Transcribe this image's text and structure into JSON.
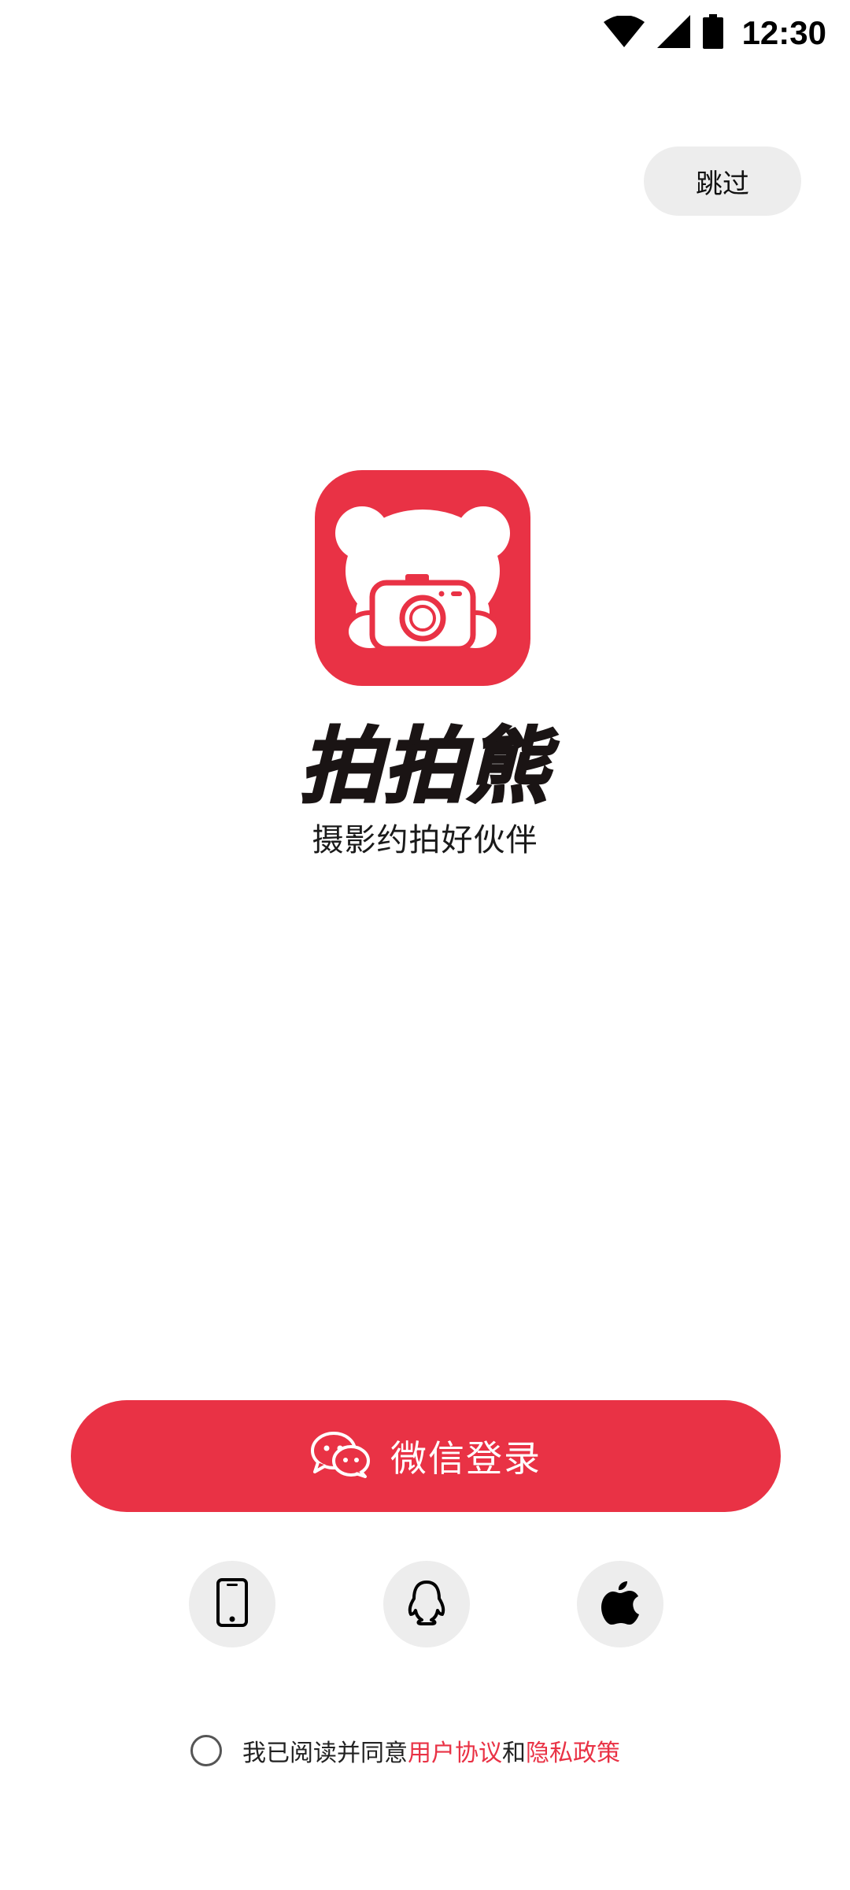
{
  "status_bar": {
    "time": "12:30",
    "icons": [
      "wifi-icon",
      "cell-signal-icon",
      "battery-icon"
    ]
  },
  "skip_label": "跳过",
  "brand": {
    "name": "拍拍熊",
    "tagline": "摄影约拍好伙伴",
    "accent_color": "#e93245",
    "logo_icon": "bear-camera-logo"
  },
  "login": {
    "wechat_label": "微信登录",
    "wechat_icon": "wechat-icon",
    "alternatives": [
      {
        "name": "phone",
        "icon": "phone-icon"
      },
      {
        "name": "qq",
        "icon": "qq-penguin-icon"
      },
      {
        "name": "apple",
        "icon": "apple-icon"
      }
    ]
  },
  "agreement": {
    "prefix": "我已阅读并同意",
    "user_agreement": "用户协议",
    "conjunction": "和",
    "privacy_policy": "隐私政策",
    "checked": false
  }
}
